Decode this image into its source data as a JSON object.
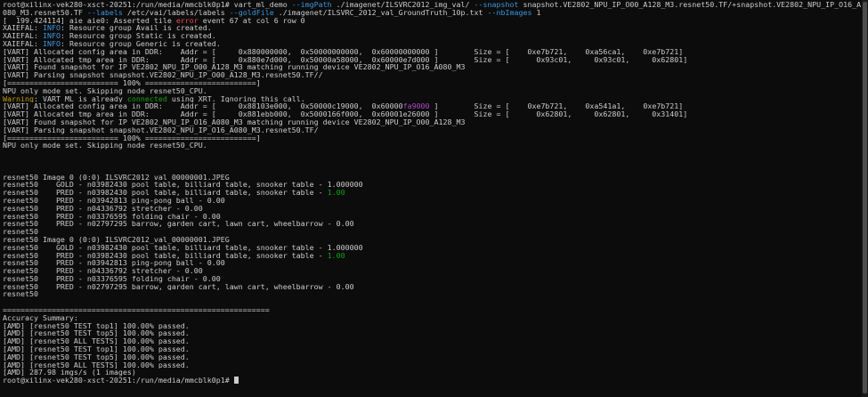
{
  "terminal": {
    "lines": [
      [
        {
          "t": "root@xilinx-vek280-xsct-20251:/run/media/mmcblk0p1# vart_ml_demo "
        },
        {
          "t": "--imgPath",
          "c": "cyan"
        },
        {
          "t": " ./imagenet/ILSVRC2012_img_val/ "
        },
        {
          "t": "--snapshot",
          "c": "cyan"
        },
        {
          "t": " snapshot.VE2802_NPU_IP_O00_A128_M3.resnet50.TF/+snapshot.VE2802_NPU_IP_O16_A"
        }
      ],
      [
        {
          "t": "080_M3.resnet50.TF "
        },
        {
          "t": "--labels",
          "c": "cyan"
        },
        {
          "t": " /etc/vai/labels/labels "
        },
        {
          "t": "--goldFile",
          "c": "cyan"
        },
        {
          "t": " ./imagenet/ILSVRC_2012_val_GroundTruth_10p.txt "
        },
        {
          "t": "--nbImages",
          "c": "cyan"
        },
        {
          "t": " 1"
        }
      ],
      [
        {
          "t": "[  199.424114] aie aie0: Asserted tile "
        },
        {
          "t": "error",
          "c": "red"
        },
        {
          "t": " event 67 at col 6 row 0"
        }
      ],
      [
        {
          "t": "XAIEFAL: "
        },
        {
          "t": "INFO",
          "c": "info"
        },
        {
          "t": ": Resource group Avail is created."
        }
      ],
      [
        {
          "t": "XAIEFAL: "
        },
        {
          "t": "INFO",
          "c": "info"
        },
        {
          "t": ": Resource group Static is created."
        }
      ],
      [
        {
          "t": "XAIEFAL: "
        },
        {
          "t": "INFO",
          "c": "info"
        },
        {
          "t": ": Resource group Generic is created."
        }
      ],
      [
        {
          "t": "[VART] Allocated config area in DDR:    Addr = [     0x880000000,  0x50000000000,  0x60000000000 ]        Size = [    0xe7b721,    0xa56ca1,    0xe7b721]"
        }
      ],
      [
        {
          "t": "[VART] Allocated tmp area in DDR:       Addr = [     0x880e7d000,  0x50000a58000,  0x60000e7d000 ]        Size = [      0x93c01,     0x93c01,     0x62801]"
        }
      ],
      [
        {
          "t": "[VART] Found snapshot for IP VE2802_NPU_IP_O00_A128_M3 matching running device VE2802_NPU_IP_O16_A080_M3"
        }
      ],
      [
        {
          "t": "[VART] Parsing snapshot snapshot.VE2802_NPU_IP_O00_A128_M3.resnet50.TF//"
        }
      ],
      [
        {
          "t": "[========================= 100% =========================]"
        }
      ],
      [
        {
          "t": "NPU only mode set. Skipping node resnet50_CPU."
        }
      ],
      [
        {
          "t": "Warning",
          "c": "warn"
        },
        {
          "t": ": VART ML is already "
        },
        {
          "t": "connected",
          "c": "green"
        },
        {
          "t": " using XRT. Ignoring this call."
        }
      ],
      [
        {
          "t": "[VART] Allocated config area in DDR:    Addr = [     0x88103e000,  0x50000c19000,  0x60000"
        },
        {
          "t": "fa9000",
          "c": "magenta"
        },
        {
          "t": " ]        Size = [    0xe7b721,    0xa541a1,    0xe7b721]"
        }
      ],
      [
        {
          "t": "[VART] Allocated tmp area in DDR:       Addr = [     0x881ebb000,  0x5000166f000,  0x60001e26000 ]        Size = [      0x62801,     0x62801,     0x31401]"
        }
      ],
      [
        {
          "t": "[VART] Found snapshot for IP VE2802_NPU_IP_O16_A080_M3 matching running device VE2802_NPU_IP_O00_A128_M3"
        }
      ],
      [
        {
          "t": "[VART] Parsing snapshot snapshot.VE2802_NPU_IP_O16_A080_M3.resnet50.TF/"
        }
      ],
      [
        {
          "t": "[========================= 100% =========================]"
        }
      ],
      [
        {
          "t": "NPU only mode set. Skipping node resnet50_CPU."
        }
      ],
      [
        {
          "t": ""
        }
      ],
      [
        {
          "t": ""
        }
      ],
      [
        {
          "t": ""
        }
      ],
      [
        {
          "t": "resnet50 Image 0 (0:0) ILSVRC2012_val_00000001.JPEG"
        }
      ],
      [
        {
          "t": "resnet50    GOLD - n03982430 pool table, billiard table, snooker table - 1.000000"
        }
      ],
      [
        {
          "t": "resnet50    PRED - n03982430 pool table, billiard table, snooker table - "
        },
        {
          "t": "1.00",
          "c": "green"
        }
      ],
      [
        {
          "t": "resnet50    PRED - n03942813 ping-pong ball - 0.00"
        }
      ],
      [
        {
          "t": "resnet50    PRED - n04336792 stretcher - 0.00"
        }
      ],
      [
        {
          "t": "resnet50    PRED - n03376595 folding chair - 0.00"
        }
      ],
      [
        {
          "t": "resnet50    PRED - n02797295 barrow, garden cart, lawn cart, wheelbarrow - 0.00"
        }
      ],
      [
        {
          "t": "resnet50"
        }
      ],
      [
        {
          "t": "resnet50 Image 0 (0:0) ILSVRC2012_val_00000001.JPEG"
        }
      ],
      [
        {
          "t": "resnet50    GOLD - n03982430 pool table, billiard table, snooker table - 1.000000"
        }
      ],
      [
        {
          "t": "resnet50    PRED - n03982430 pool table, billiard table, snooker table - "
        },
        {
          "t": "1.00",
          "c": "green"
        }
      ],
      [
        {
          "t": "resnet50    PRED - n03942813 ping-pong ball - 0.00"
        }
      ],
      [
        {
          "t": "resnet50    PRED - n04336792 stretcher - 0.00"
        }
      ],
      [
        {
          "t": "resnet50    PRED - n03376595 folding chair - 0.00"
        }
      ],
      [
        {
          "t": "resnet50    PRED - n02797295 barrow, garden cart, lawn cart, wheelbarrow - 0.00"
        }
      ],
      [
        {
          "t": "resnet50"
        }
      ],
      [
        {
          "t": ""
        }
      ],
      [
        {
          "t": "============================================================"
        }
      ],
      [
        {
          "t": "Accuracy Summary:"
        }
      ],
      [
        {
          "t": "[AMD] [resnet50 TEST top1] 100.00% passed."
        }
      ],
      [
        {
          "t": "[AMD] [resnet50 TEST top5] 100.00% passed."
        }
      ],
      [
        {
          "t": "[AMD] [resnet50 ALL TESTS] 100.00% passed."
        }
      ],
      [
        {
          "t": "[AMD] [resnet50 TEST top1] 100.00% passed."
        }
      ],
      [
        {
          "t": "[AMD] [resnet50 TEST top5] 100.00% passed."
        }
      ],
      [
        {
          "t": "[AMD] [resnet50 ALL TESTS] 100.00% passed."
        }
      ],
      [
        {
          "t": "[AMD] 287.98 imgs/s (1 images)"
        }
      ],
      [
        {
          "t": "root@xilinx-vek280-xsct-20251:/run/media/mmcblk0p1# "
        },
        {
          "t": "",
          "cursor": true
        }
      ]
    ]
  },
  "colors": {
    "background": "#0c0c0c",
    "text": "#cccccc",
    "option": "#3a96dd",
    "info": "#3a96dd",
    "warning": "#c19c00",
    "success": "#13a10e",
    "highlight": "#b148c6",
    "error": "#e74856"
  }
}
